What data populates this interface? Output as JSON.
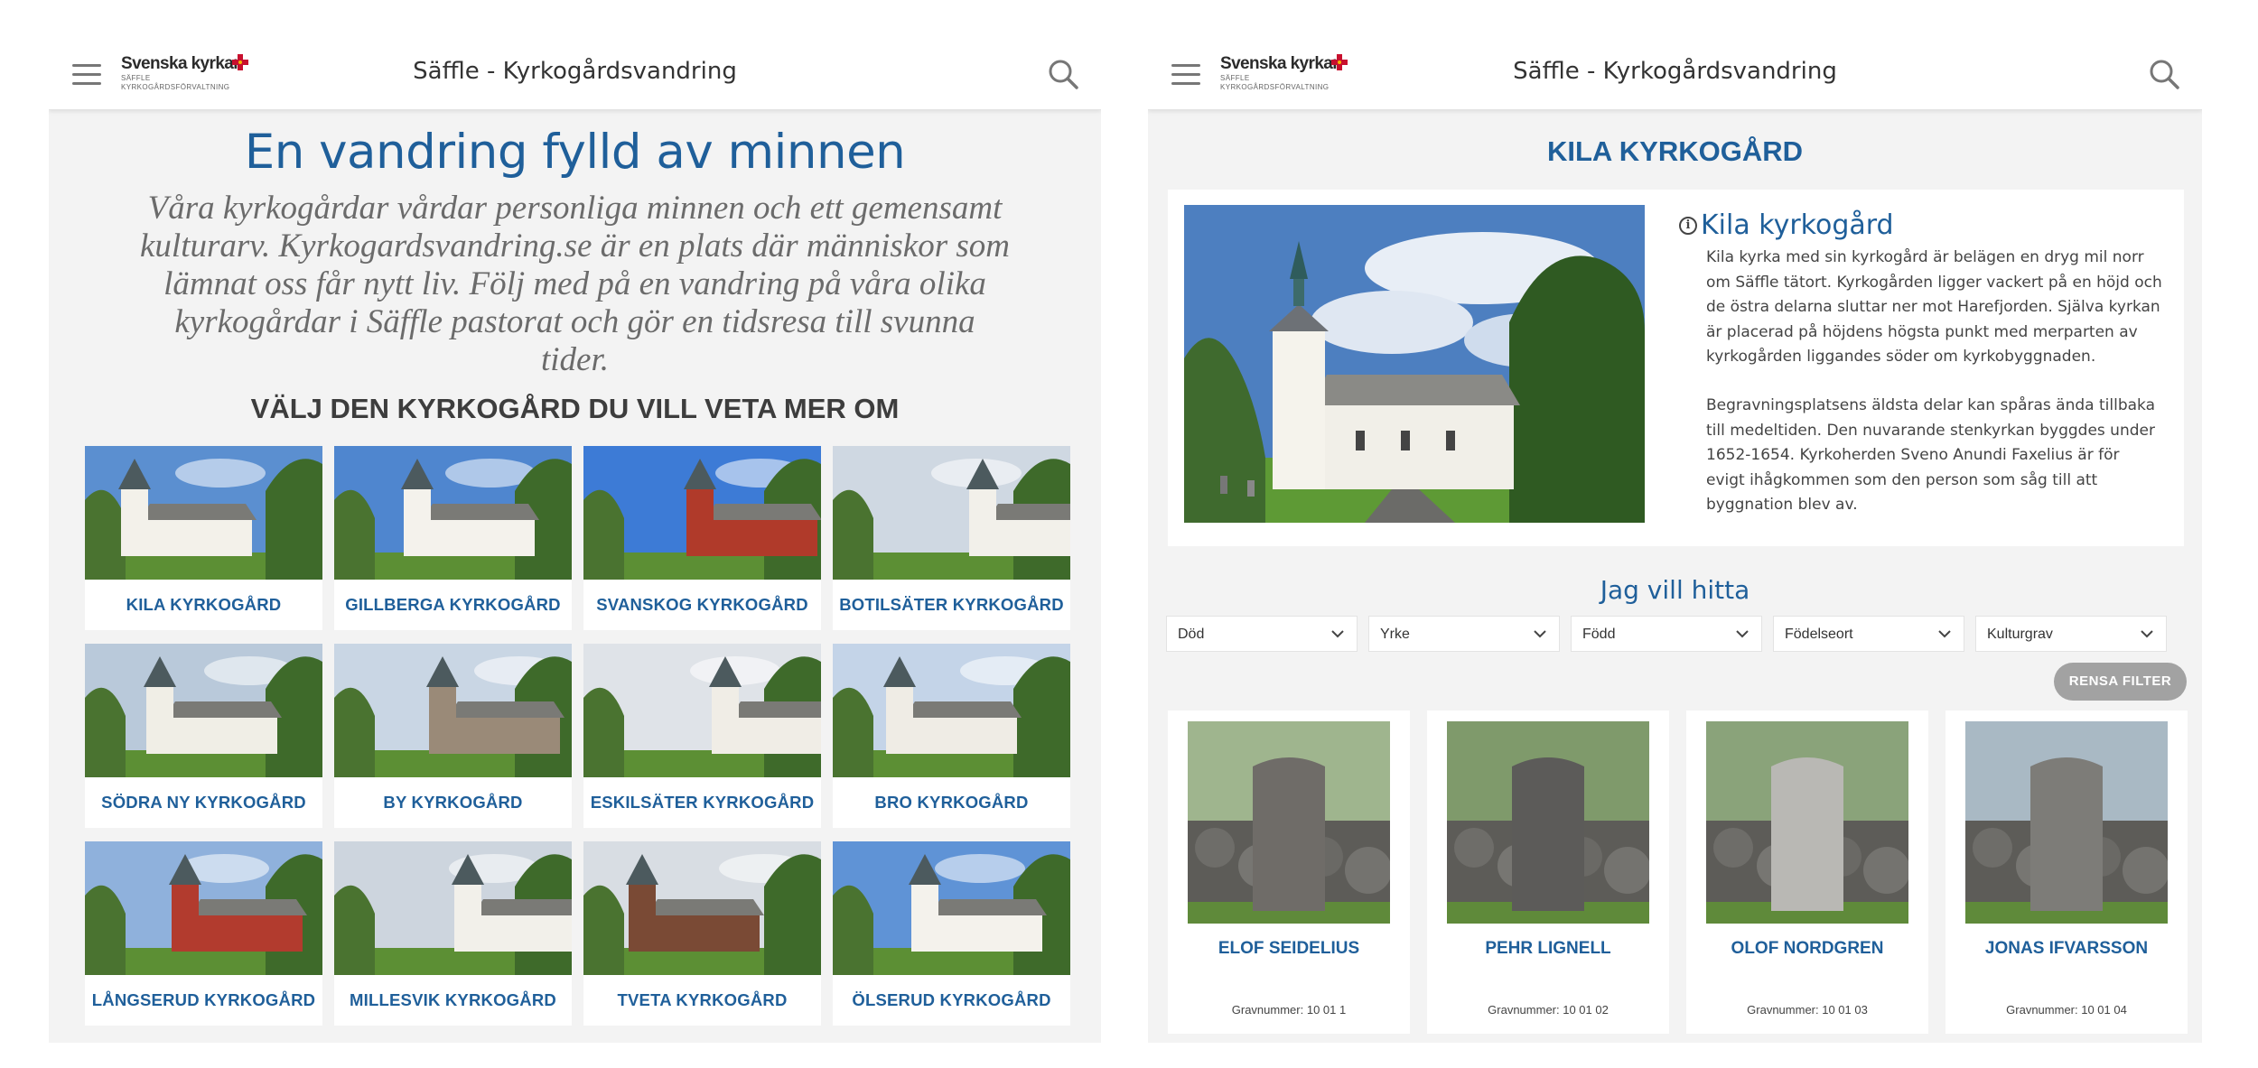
{
  "app": {
    "title": "Säffle - Kyrkogårdsvandring",
    "logo_name": "Svenska kyrkan",
    "logo_sub_1": "SÄFFLE",
    "logo_sub_2": "KYRKOGÅRDSFÖRVALTNING"
  },
  "left": {
    "hero_title": "En vandring fylld av minnen",
    "hero_text": "Våra kyrkogårdar vårdar personliga minnen och ett gemensamt kulturarv. Kyrkogardsvandring.se är en plats där människor som lämnat oss får nytt liv. Följ med på en vandring på våra olika kyrkogårdar i Säffle pastorat och gör en tidsresa till svunna tider.",
    "section_heading": "VÄLJ DEN KYRKOGÅRD DU VILL VETA MER OM",
    "cemeteries": [
      "KILA KYRKOGÅRD",
      "GILLBERGA KYRKOGÅRD",
      "SVANSKOG KYRKOGÅRD",
      "BOTILSÄTER KYRKOGÅRD",
      "SÖDRA NY KYRKOGÅRD",
      "BY KYRKOGÅRD",
      "ESKILSÄTER KYRKOGÅRD",
      "BRO KYRKOGÅRD",
      "LÅNGSERUD KYRKOGÅRD",
      "MILLESVIK KYRKOGÅRD",
      "TVETA KYRKOGÅRD",
      "ÖLSERUD KYRKOGÅRD"
    ]
  },
  "right": {
    "church_title": "KILA KYRKOGÅRD",
    "info_heading": "Kila kyrkogård",
    "info_p1": "Kila kyrka med sin kyrkogård är belägen en dryg mil norr om Säffle tätort. Kyrkogården ligger vackert på en höjd och de östra delarna sluttar ner mot Harefjorden. Själva kyrkan är placerad på höjdens högsta punkt med merparten av kyrkogården liggandes söder om kyrkobyggnaden.",
    "info_p2": "Begravningsplatsens äldsta delar kan spåras ända tillbaka till medeltiden. Den nuvarande stenkyrkan byggdes under 1652-1654. Kyrkoherden Sveno Anundi Faxelius är för evigt ihågkommen som den person som såg till att byggnation blev av.",
    "find_heading": "Jag vill hitta",
    "filters": [
      "Död",
      "Yrke",
      "Född",
      "Födelseort",
      "Kulturgrav"
    ],
    "reset_label": "RENSA FILTER",
    "graves": [
      {
        "name": "ELOF SEIDELIUS",
        "number": "Gravnummer: 10 01 1"
      },
      {
        "name": "PEHR LIGNELL",
        "number": "Gravnummer: 10 01 02"
      },
      {
        "name": "OLOF NORDGREN",
        "number": "Gravnummer: 10 01 03"
      },
      {
        "name": "JONAS IFVARSSON",
        "number": "Gravnummer: 10 01 04"
      }
    ]
  },
  "colors": {
    "accent_blue": "#1f5f9a",
    "panel_bg": "#f3f3f3",
    "button_grey": "#a2a2a2",
    "brand_red": "#c8102e"
  },
  "icons": [
    "menu-icon",
    "search-icon",
    "info-icon",
    "chevron-down-icon"
  ]
}
